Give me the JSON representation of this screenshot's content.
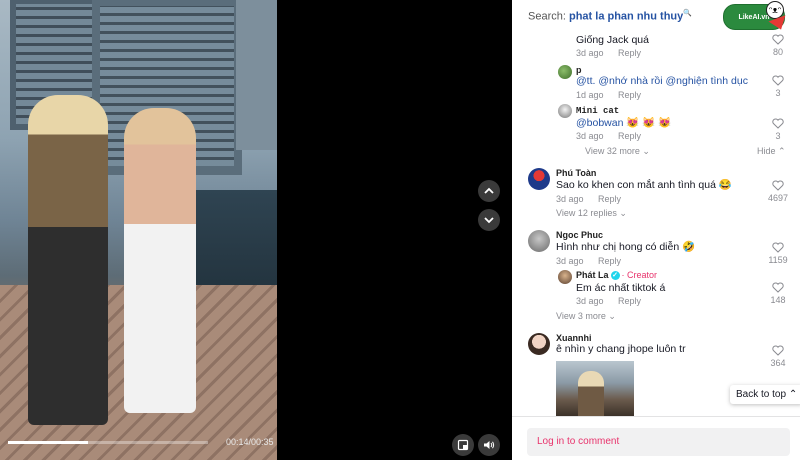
{
  "video": {
    "time_display": "00:14/00:35",
    "progress": 0.4
  },
  "search": {
    "label": "Search:",
    "query": "phat la phan nhu thuy"
  },
  "brand": {
    "logo_text": "LikeAI.vn"
  },
  "comments": [
    {
      "id": "r1",
      "username": "",
      "text": "Giống Jack quá",
      "date": "3d ago",
      "reply_label": "Reply",
      "likes": "80"
    },
    {
      "id": "r2",
      "username": "p",
      "text_mention": "@tt. @nhớ nhà rồi @nghiện tình dục",
      "date": "1d ago",
      "reply_label": "Reply",
      "likes": "3"
    },
    {
      "id": "r3",
      "username": "Mini cat",
      "text_mention": "@bobwan",
      "text_emoji": "😻 😻 😻",
      "date": "3d ago",
      "reply_label": "Reply",
      "likes": "3"
    },
    {
      "id": "c1",
      "username": "Phú Toàn",
      "text": "Sao ko khen con mắt anh tình quá",
      "text_emoji": "😂",
      "date": "3d ago",
      "reply_label": "Reply",
      "likes": "4697"
    },
    {
      "id": "c2",
      "username": "Ngoc Phuc",
      "text": "Hình như chị hong có diễn",
      "text_emoji": "🤣",
      "date": "3d ago",
      "reply_label": "Reply",
      "likes": "1159"
    },
    {
      "id": "r4",
      "username": "Phát La",
      "creator_label": "Creator",
      "text": "Em ác nhất tiktok á",
      "date": "3d ago",
      "reply_label": "Reply",
      "likes": "148"
    },
    {
      "id": "c3",
      "username": "Xuannhi",
      "text": "ê nhìn y chang jhope luôn tr",
      "likes": "364"
    }
  ],
  "view_more": {
    "first_thread": "View 32 more",
    "hide": "Hide",
    "phu_toan": "View 12 replies",
    "ngoc_phuc": "View 3 more"
  },
  "back_to_top": "Back to top",
  "login_prompt": "Log in to comment",
  "colors": {
    "accent": "#e8336c",
    "mention": "#2653a3",
    "muted": "#8a8b91"
  }
}
